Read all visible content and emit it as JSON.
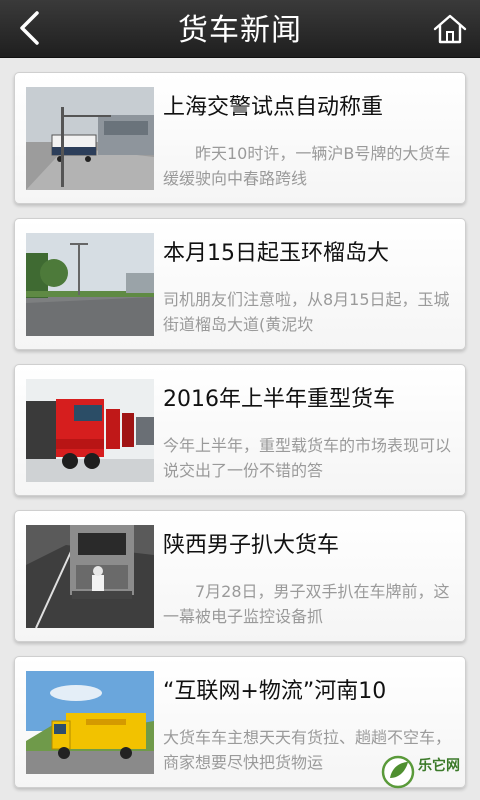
{
  "header": {
    "title": "货车新闻",
    "back_icon": "chevron-left-icon",
    "home_icon": "home-icon"
  },
  "news": [
    {
      "title": "上海交警试点自动称重",
      "summary": "　　昨天10时许，一辆沪B号牌的大货车缓缓驶向中春路跨线"
    },
    {
      "title": "本月15日起玉环榴岛大",
      "summary": "司机朋友们注意啦，从8月15日起，玉城街道榴岛大道(黄泥坎"
    },
    {
      "title": "2016年上半年重型货车",
      "summary": "今年上半年，重型载货车的市场表现可以说交出了一份不错的答"
    },
    {
      "title": "陕西男子扒大货车",
      "summary": "　　7月28日，男子双手扒在车牌前，这一幕被电子监控设备抓"
    },
    {
      "title": "“互联网+物流”河南10",
      "summary": "大货车车主想天天有货拉、趟趟不空车，商家想要尽快把货物运"
    }
  ],
  "watermark": {
    "text": "乐它网"
  },
  "colors": {
    "header": "#2b2b2b",
    "background": "#e9e9e9",
    "summary": "#9a9a9a"
  }
}
